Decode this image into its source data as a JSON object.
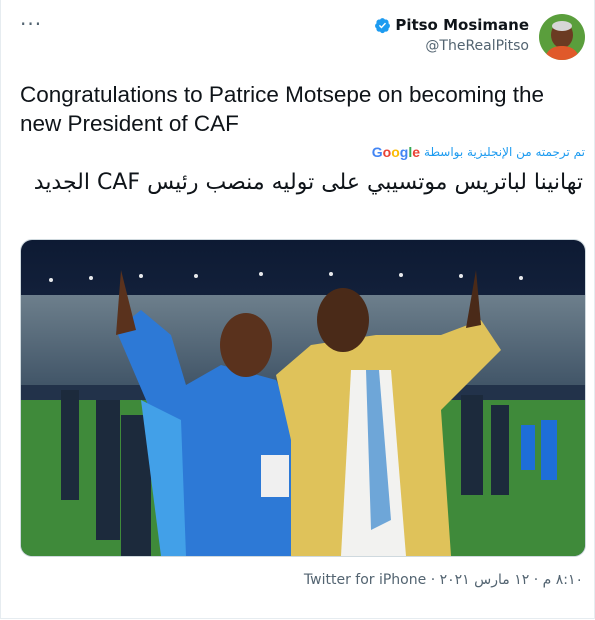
{
  "tweet": {
    "more_icon_text": "···",
    "author_name": "Pitso Mosimane",
    "author_handle": "@TheRealPitso",
    "text_en": "Congratulations to Patrice Motsepe on becoming the new President of CAF",
    "translated_by_label": "تم ترجمته من الإنجليزية بواسطة",
    "translation_provider": "Google",
    "text_ar": "تهانينا لباتريس موتسيبي على توليه منصب رئيس CAF الجديد",
    "timestamp": "٨:١٠ م · ١٢ مارس ٢٠٢١",
    "source": "Twitter for iPhone"
  },
  "colors": {
    "accent": "#1d9bf0",
    "secondary_text": "#536471",
    "primary_text": "#0f1419"
  },
  "icons": [
    "more-icon",
    "verified-badge-icon",
    "avatar"
  ]
}
